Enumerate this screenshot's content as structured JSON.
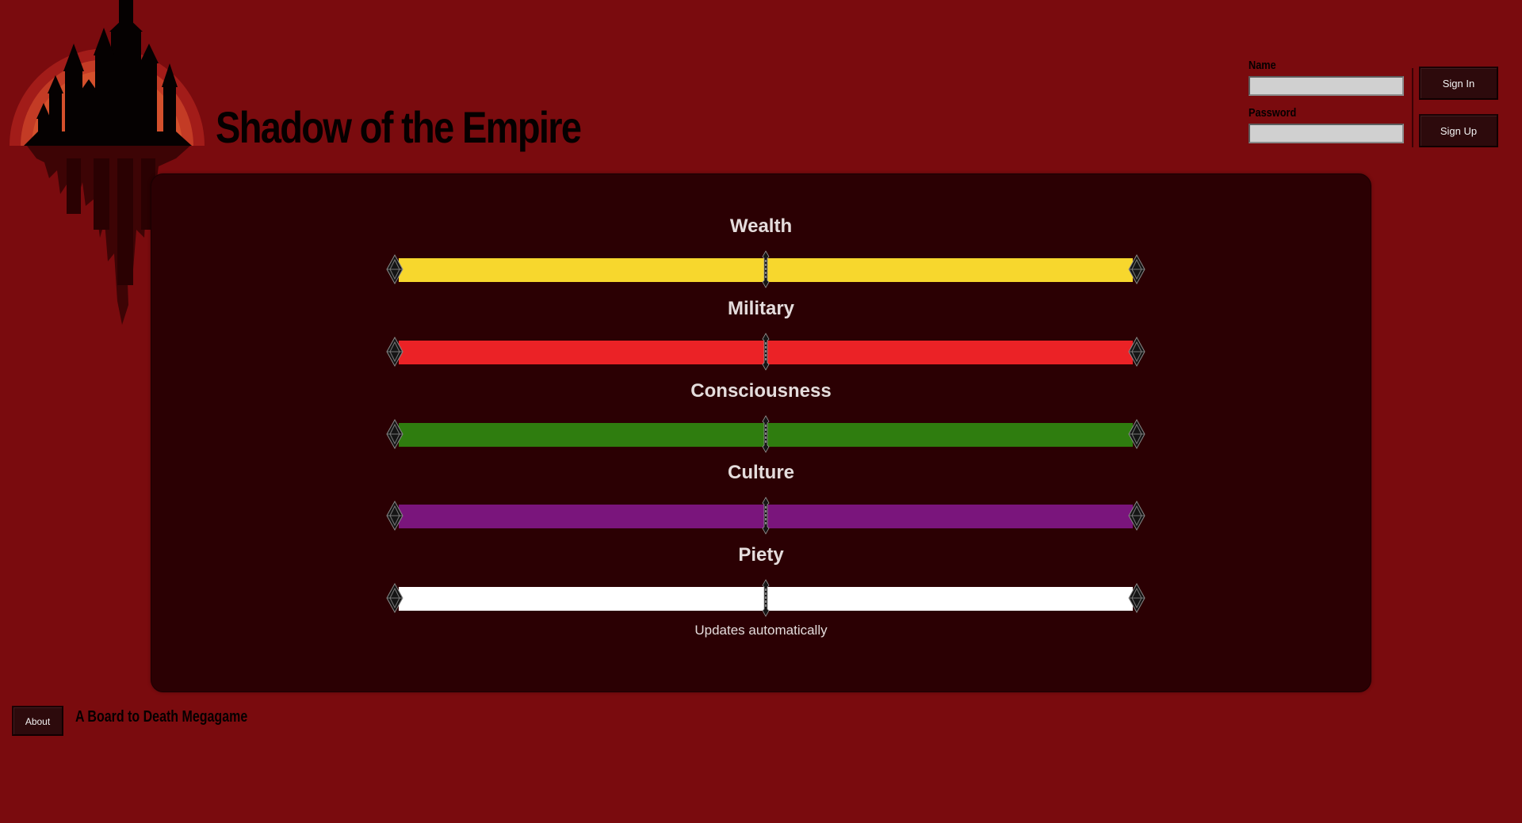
{
  "header": {
    "title": "Shadow of the Empire"
  },
  "login": {
    "name_label": "Name",
    "name_value": "",
    "password_label": "Password",
    "password_value": "",
    "sign_in_label": "Sign In",
    "sign_up_label": "Sign Up"
  },
  "meters": [
    {
      "label": "Wealth",
      "color": "#f7d72d",
      "level": 0.5
    },
    {
      "label": "Military",
      "color": "#eb2226",
      "level": 0.5
    },
    {
      "label": "Consciousness",
      "color": "#2f7d0f",
      "level": 0.5
    },
    {
      "label": "Culture",
      "color": "#7a157c",
      "level": 0.5
    },
    {
      "label": "Piety",
      "color": "#ffffff",
      "level": 0.5
    }
  ],
  "status": {
    "update_note": "Updates automatically"
  },
  "footer": {
    "about_label": "About",
    "tagline": "A Board to Death Megagame"
  },
  "theme": {
    "background": "#7a0b0e",
    "panel": "#2b0003"
  }
}
